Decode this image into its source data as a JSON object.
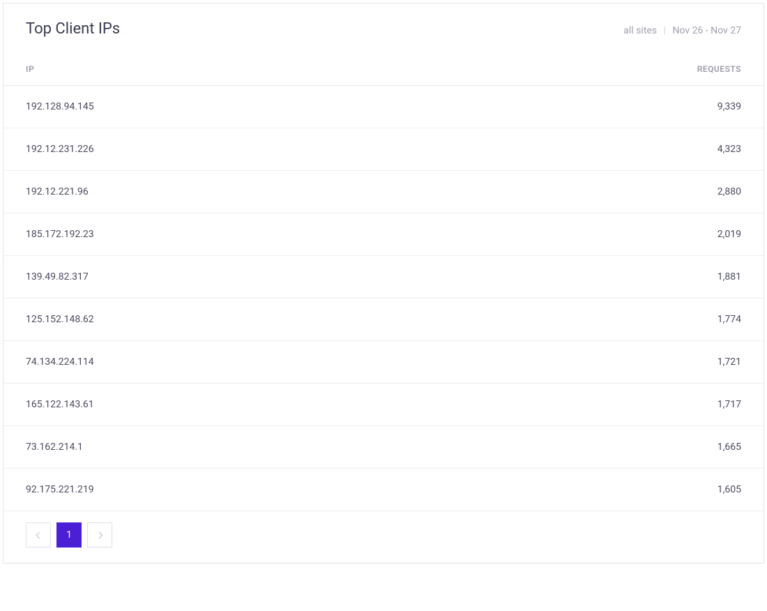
{
  "panel": {
    "title": "Top Client IPs",
    "meta_scope": "all sites",
    "meta_range": "Nov 26 - Nov 27"
  },
  "table": {
    "headers": {
      "ip": "IP",
      "requests": "REQUESTS"
    },
    "rows": [
      {
        "ip": "192.128.94.145",
        "requests": "9,339"
      },
      {
        "ip": "192.12.231.226",
        "requests": "4,323"
      },
      {
        "ip": "192.12.221.96",
        "requests": "2,880"
      },
      {
        "ip": "185.172.192.23",
        "requests": "2,019"
      },
      {
        "ip": "139.49.82.317",
        "requests": "1,881"
      },
      {
        "ip": "125.152.148.62",
        "requests": "1,774"
      },
      {
        "ip": "74.134.224.114",
        "requests": "1,721"
      },
      {
        "ip": "165.122.143.61",
        "requests": "1,717"
      },
      {
        "ip": "73.162.214.1",
        "requests": "1,665"
      },
      {
        "ip": "92.175.221.219",
        "requests": "1,605"
      }
    ]
  },
  "pagination": {
    "current": "1"
  }
}
